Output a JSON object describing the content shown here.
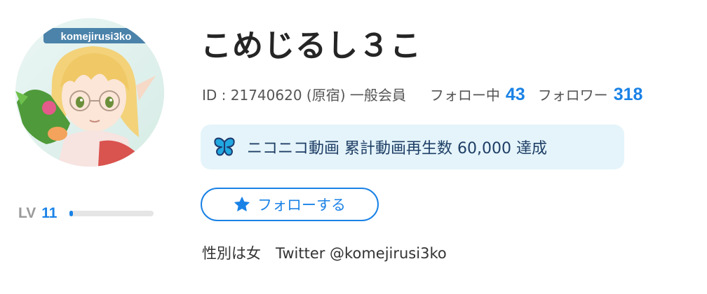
{
  "profile": {
    "username": "こめじるし３こ",
    "id_text": "ID : 21740620 (原宿) 一般会員",
    "following_label": "フォロー中",
    "following_count": "43",
    "followers_label": "フォロワー",
    "followers_count": "318",
    "avatar_label": "komejirusi3ko"
  },
  "level": {
    "label": "LV",
    "value": "11",
    "progress": 0.04
  },
  "achievement": {
    "icon": "butterfly-icon",
    "text": "ニコニコ動画 累計動画再生数 60,000 達成"
  },
  "follow_button": {
    "icon": "star-icon",
    "label": "フォローする"
  },
  "description": "性別は女　Twitter @komejirusi3ko",
  "colors": {
    "accent": "#1a82e6",
    "achievement_bg": "#e4f4fa",
    "achievement_text": "#1f3e66",
    "level_track": "#e5e5e5"
  }
}
